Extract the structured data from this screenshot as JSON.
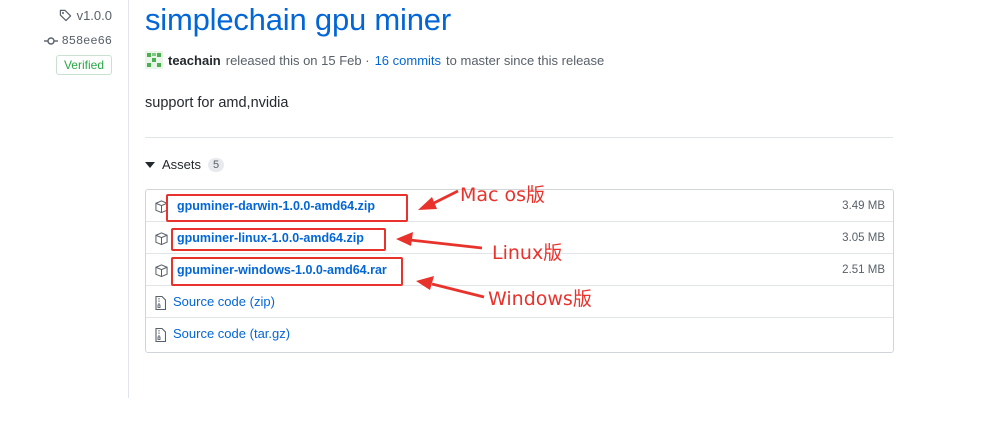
{
  "sidebar": {
    "tag": "v1.0.0",
    "commit": "858ee66",
    "verified": "Verified"
  },
  "release": {
    "title": "simplechain gpu miner",
    "author": "teachain",
    "released_text": "released this on 15 Feb ·",
    "commits_link": "16 commits",
    "since_text": "to master since this release",
    "description": "support for amd,nvidia"
  },
  "assets": {
    "label": "Assets",
    "count": "5",
    "files": [
      {
        "name": "gpuminer-darwin-1.0.0-amd64.zip",
        "size": "3.49 MB"
      },
      {
        "name": "gpuminer-linux-1.0.0-amd64.zip",
        "size": "3.05 MB"
      },
      {
        "name": "gpuminer-windows-1.0.0-amd64.rar",
        "size": "2.51 MB"
      }
    ],
    "source": [
      {
        "label": "Source code",
        "ext": "(zip)"
      },
      {
        "label": "Source code",
        "ext": "(tar.gz)"
      }
    ]
  },
  "annotations": {
    "mac": "Mac os版",
    "linux": "Linux版",
    "windows": "Windows版",
    "color": "#e8322c"
  },
  "colors": {
    "link": "#0366d6",
    "verified": "#28a745",
    "muted": "#586069"
  },
  "icons": [
    "tag-icon",
    "commit-icon",
    "avatar",
    "caret-down-icon",
    "package-icon",
    "file-zip-icon",
    "arrow-icon"
  ]
}
